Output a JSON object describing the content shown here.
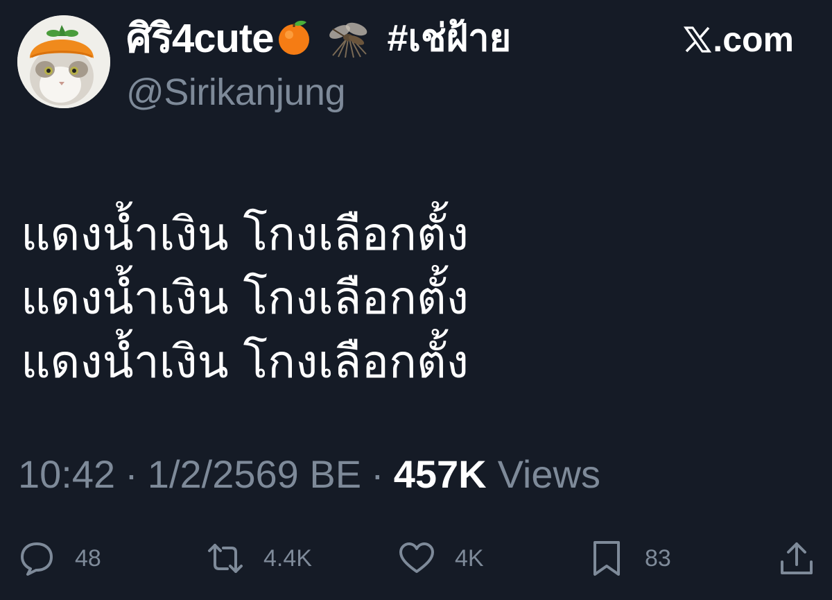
{
  "author": {
    "display_name": "ศิริ4cute",
    "hashtag": "#เช่ฝ้าย",
    "handle": "@Sirikanjung",
    "avatar_icon": "cat-with-orange-hat-avatar"
  },
  "brand": {
    "label": ".com",
    "icon": "x-logo-icon"
  },
  "tweet": {
    "lines": [
      "แดงน้ำเงิน โกงเลือกตั้ง",
      "แดงน้ำเงิน โกงเลือกตั้ง",
      "แดงน้ำเงิน โกงเลือกตั้ง"
    ]
  },
  "meta": {
    "time": "10:42",
    "separator": "·",
    "date": "1/2/2569 BE",
    "views_count": "457K",
    "views_label": "Views"
  },
  "actions": {
    "replies": {
      "icon": "reply-icon",
      "count": "48"
    },
    "reposts": {
      "icon": "repost-icon",
      "count": "4.4K"
    },
    "likes": {
      "icon": "heart-icon",
      "count": "4K"
    },
    "bookmarks": {
      "icon": "bookmark-icon",
      "count": "83"
    },
    "share": {
      "icon": "share-icon"
    }
  },
  "colors": {
    "background": "#151b26",
    "primary_text": "#ffffff",
    "secondary_text": "#7e8a99"
  }
}
